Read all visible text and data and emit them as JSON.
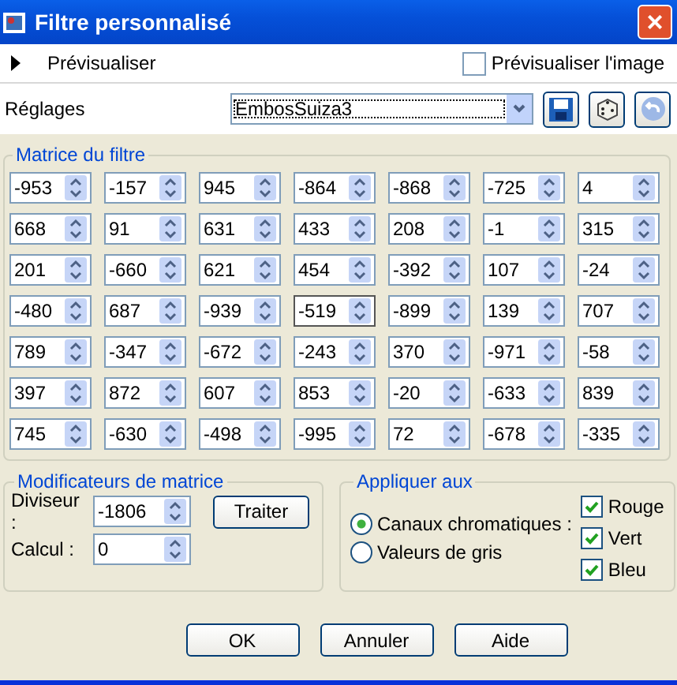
{
  "window": {
    "title": "Filtre personnalisé",
    "close": "×"
  },
  "preview": {
    "label": "Prévisualiser",
    "expanded": false,
    "image_checkbox": {
      "label": "Prévisualiser l'image",
      "checked": false
    }
  },
  "settings": {
    "label": "Réglages",
    "value": "EmbosSuiza3"
  },
  "matrix": {
    "title": "Matrice du filtre",
    "rows": [
      [
        {
          "value": "-953",
          "focused": false
        },
        {
          "value": "-157",
          "focused": false
        },
        {
          "value": "945",
          "focused": false
        },
        {
          "value": "-864",
          "focused": false
        },
        {
          "value": "-868",
          "focused": false
        },
        {
          "value": "-725",
          "focused": false
        },
        {
          "value": "4",
          "focused": false
        }
      ],
      [
        {
          "value": "668",
          "focused": false
        },
        {
          "value": "91",
          "focused": false
        },
        {
          "value": "631",
          "focused": false
        },
        {
          "value": "433",
          "focused": false
        },
        {
          "value": "208",
          "focused": false
        },
        {
          "value": "-1",
          "focused": false
        },
        {
          "value": "315",
          "focused": false
        }
      ],
      [
        {
          "value": "201",
          "focused": false
        },
        {
          "value": "-660",
          "focused": false
        },
        {
          "value": "621",
          "focused": false
        },
        {
          "value": "454",
          "focused": false
        },
        {
          "value": "-392",
          "focused": false
        },
        {
          "value": "107",
          "focused": false
        },
        {
          "value": "-24",
          "focused": false
        }
      ],
      [
        {
          "value": "-480",
          "focused": false
        },
        {
          "value": "687",
          "focused": false
        },
        {
          "value": "-939",
          "focused": false
        },
        {
          "value": "-519",
          "focused": true
        },
        {
          "value": "-899",
          "focused": false
        },
        {
          "value": "139",
          "focused": false
        },
        {
          "value": "707",
          "focused": false
        }
      ],
      [
        {
          "value": "789",
          "focused": false
        },
        {
          "value": "-347",
          "focused": false
        },
        {
          "value": "-672",
          "focused": false
        },
        {
          "value": "-243",
          "focused": false
        },
        {
          "value": "370",
          "focused": false
        },
        {
          "value": "-971",
          "focused": false
        },
        {
          "value": "-58",
          "focused": false
        }
      ],
      [
        {
          "value": "397",
          "focused": false
        },
        {
          "value": "872",
          "focused": false
        },
        {
          "value": "607",
          "focused": false
        },
        {
          "value": "853",
          "focused": false
        },
        {
          "value": "-20",
          "focused": false
        },
        {
          "value": "-633",
          "focused": false
        },
        {
          "value": "839",
          "focused": false
        }
      ],
      [
        {
          "value": "745",
          "focused": false
        },
        {
          "value": "-630",
          "focused": false
        },
        {
          "value": "-498",
          "focused": false
        },
        {
          "value": "-995",
          "focused": false
        },
        {
          "value": "72",
          "focused": false
        },
        {
          "value": "-678",
          "focused": false
        },
        {
          "value": "-335",
          "focused": false
        }
      ]
    ]
  },
  "modifiers": {
    "title": "Modificateurs de matrice",
    "divisor": {
      "label": "Diviseur :",
      "value": "-1806"
    },
    "offset": {
      "label": "Calcul :",
      "value": "0"
    },
    "process_button": "Traiter"
  },
  "apply_to": {
    "title": "Appliquer aux",
    "options": [
      {
        "label": "Canaux chromatiques :",
        "selected": true
      },
      {
        "label": "Valeurs de gris",
        "selected": false
      }
    ],
    "channels": [
      {
        "label": "Rouge",
        "checked": true
      },
      {
        "label": "Vert",
        "checked": true
      },
      {
        "label": "Bleu",
        "checked": true
      }
    ]
  },
  "buttons": [
    "OK",
    "Annuler",
    "Aide"
  ]
}
